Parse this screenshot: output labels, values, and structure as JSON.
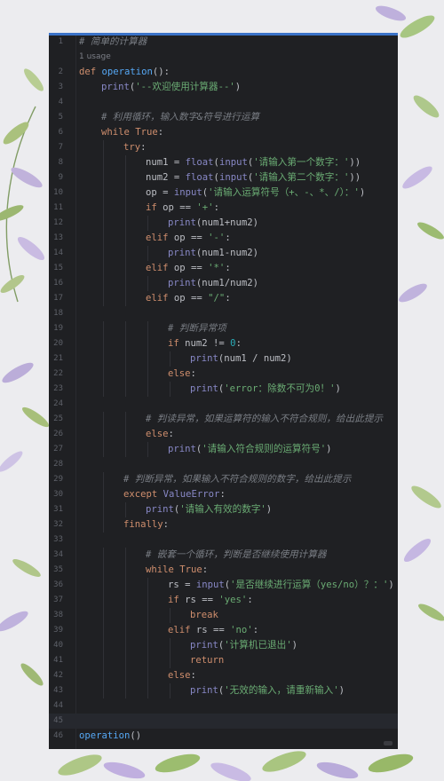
{
  "colors": {
    "editor_bg": "#1f2023",
    "keyword": "#cf8e6d",
    "function": "#56a8f5",
    "builtin": "#8888c6",
    "string": "#6aab73",
    "number": "#2aacb8",
    "comment": "#7a7e85"
  },
  "usage_hint": "1 usage",
  "current_line": 45,
  "lines": [
    {
      "n": "1",
      "i": 0,
      "t": [
        [
          "cm",
          "# 简单的计算器"
        ]
      ]
    },
    {
      "n": "2",
      "i": 0,
      "t": [
        [
          "kw",
          "def "
        ],
        [
          "fn",
          "operation"
        ],
        [
          "op",
          "():"
        ]
      ]
    },
    {
      "n": "3",
      "i": 1,
      "t": [
        [
          "bi",
          "print"
        ],
        [
          "op",
          "("
        ],
        [
          "str",
          "'--欢迎使用计算器--'"
        ],
        [
          "op",
          ")"
        ]
      ]
    },
    {
      "n": "4",
      "i": 0,
      "t": []
    },
    {
      "n": "5",
      "i": 1,
      "t": [
        [
          "cm",
          "# 利用循环，输入数字&符号进行运算"
        ]
      ]
    },
    {
      "n": "6",
      "i": 1,
      "t": [
        [
          "kw",
          "while "
        ],
        [
          "kw",
          "True"
        ],
        [
          "op",
          ":"
        ]
      ]
    },
    {
      "n": "7",
      "i": 2,
      "t": [
        [
          "kw",
          "try"
        ],
        [
          "op",
          ":"
        ]
      ]
    },
    {
      "n": "8",
      "i": 3,
      "t": [
        [
          "op",
          "num1 = "
        ],
        [
          "bi",
          "float"
        ],
        [
          "op",
          "("
        ],
        [
          "bi",
          "input"
        ],
        [
          "op",
          "("
        ],
        [
          "str",
          "'请输入第一个数字：'"
        ],
        [
          "op",
          "))"
        ]
      ]
    },
    {
      "n": "9",
      "i": 3,
      "t": [
        [
          "op",
          "num2 = "
        ],
        [
          "bi",
          "float"
        ],
        [
          "op",
          "("
        ],
        [
          "bi",
          "input"
        ],
        [
          "op",
          "("
        ],
        [
          "str",
          "'请输入第二个数字：'"
        ],
        [
          "op",
          "))"
        ]
      ]
    },
    {
      "n": "10",
      "i": 3,
      "t": [
        [
          "op",
          "op = "
        ],
        [
          "bi",
          "input"
        ],
        [
          "op",
          "("
        ],
        [
          "str",
          "'请输入运算符号（+、-、*、/）：'"
        ],
        [
          "op",
          ")"
        ]
      ]
    },
    {
      "n": "11",
      "i": 3,
      "t": [
        [
          "kw",
          "if "
        ],
        [
          "op",
          "op == "
        ],
        [
          "str",
          "'+'"
        ],
        [
          "op",
          ":"
        ]
      ]
    },
    {
      "n": "12",
      "i": 4,
      "t": [
        [
          "bi",
          "print"
        ],
        [
          "op",
          "(num1+num2)"
        ]
      ]
    },
    {
      "n": "13",
      "i": 3,
      "t": [
        [
          "kw",
          "elif "
        ],
        [
          "op",
          "op == "
        ],
        [
          "str",
          "'-'"
        ],
        [
          "op",
          ":"
        ]
      ]
    },
    {
      "n": "14",
      "i": 4,
      "t": [
        [
          "bi",
          "print"
        ],
        [
          "op",
          "(num1-num2)"
        ]
      ]
    },
    {
      "n": "15",
      "i": 3,
      "t": [
        [
          "kw",
          "elif "
        ],
        [
          "op",
          "op == "
        ],
        [
          "str",
          "'*'"
        ],
        [
          "op",
          ":"
        ]
      ]
    },
    {
      "n": "16",
      "i": 4,
      "t": [
        [
          "bi",
          "print"
        ],
        [
          "op",
          "(num1/num2)"
        ]
      ]
    },
    {
      "n": "17",
      "i": 3,
      "t": [
        [
          "kw",
          "elif "
        ],
        [
          "op",
          "op == "
        ],
        [
          "str",
          "\"/\""
        ],
        [
          "op",
          ":"
        ]
      ]
    },
    {
      "n": "18",
      "i": 0,
      "t": []
    },
    {
      "n": "19",
      "i": 4,
      "t": [
        [
          "cm",
          "# 判断异常项"
        ]
      ]
    },
    {
      "n": "20",
      "i": 4,
      "t": [
        [
          "kw",
          "if "
        ],
        [
          "op",
          "num2 != "
        ],
        [
          "num",
          "0"
        ],
        [
          "op",
          ":"
        ]
      ]
    },
    {
      "n": "21",
      "i": 5,
      "t": [
        [
          "bi",
          "print"
        ],
        [
          "op",
          "(num1 / num2)"
        ]
      ]
    },
    {
      "n": "22",
      "i": 4,
      "t": [
        [
          "kw",
          "else"
        ],
        [
          "op",
          ":"
        ]
      ]
    },
    {
      "n": "23",
      "i": 5,
      "t": [
        [
          "bi",
          "print"
        ],
        [
          "op",
          "("
        ],
        [
          "str",
          "'error：除数不可为0！'"
        ],
        [
          "op",
          ")"
        ]
      ]
    },
    {
      "n": "24",
      "i": 0,
      "t": []
    },
    {
      "n": "25",
      "i": 3,
      "t": [
        [
          "cm",
          "# 判读异常，如果运算符的输入不符合规则，给出此提示"
        ]
      ]
    },
    {
      "n": "26",
      "i": 3,
      "t": [
        [
          "kw",
          "else"
        ],
        [
          "op",
          ":"
        ]
      ]
    },
    {
      "n": "27",
      "i": 4,
      "t": [
        [
          "bi",
          "print"
        ],
        [
          "op",
          "("
        ],
        [
          "str",
          "'请输入符合规则的运算符号'"
        ],
        [
          "op",
          ")"
        ]
      ]
    },
    {
      "n": "28",
      "i": 0,
      "t": []
    },
    {
      "n": "29",
      "i": 2,
      "t": [
        [
          "cm",
          "# 判断异常，如果输入不符合规则的数字，给出此提示"
        ]
      ]
    },
    {
      "n": "30",
      "i": 2,
      "t": [
        [
          "kw",
          "except "
        ],
        [
          "bi",
          "ValueError"
        ],
        [
          "op",
          ":"
        ]
      ]
    },
    {
      "n": "31",
      "i": 3,
      "t": [
        [
          "bi",
          "print"
        ],
        [
          "op",
          "("
        ],
        [
          "str",
          "'请输入有效的数字'"
        ],
        [
          "op",
          ")"
        ]
      ]
    },
    {
      "n": "32",
      "i": 2,
      "t": [
        [
          "kw",
          "finally"
        ],
        [
          "op",
          ":"
        ]
      ]
    },
    {
      "n": "33",
      "i": 0,
      "t": []
    },
    {
      "n": "34",
      "i": 3,
      "t": [
        [
          "cm",
          "# 嵌套一个循环，判断是否继续使用计算器"
        ]
      ]
    },
    {
      "n": "35",
      "i": 3,
      "t": [
        [
          "kw",
          "while "
        ],
        [
          "kw",
          "True"
        ],
        [
          "op",
          ":"
        ]
      ]
    },
    {
      "n": "36",
      "i": 4,
      "t": [
        [
          "op",
          "rs = "
        ],
        [
          "bi",
          "input"
        ],
        [
          "op",
          "("
        ],
        [
          "str",
          "'是否继续进行运算（yes/no）？：'"
        ],
        [
          "op",
          ")"
        ]
      ]
    },
    {
      "n": "37",
      "i": 4,
      "t": [
        [
          "kw",
          "if "
        ],
        [
          "op",
          "rs == "
        ],
        [
          "str",
          "'yes'"
        ],
        [
          "op",
          ":"
        ]
      ]
    },
    {
      "n": "38",
      "i": 5,
      "t": [
        [
          "kw",
          "break"
        ]
      ]
    },
    {
      "n": "39",
      "i": 4,
      "t": [
        [
          "kw",
          "elif "
        ],
        [
          "op",
          "rs == "
        ],
        [
          "str",
          "'no'"
        ],
        [
          "op",
          ":"
        ]
      ]
    },
    {
      "n": "40",
      "i": 5,
      "t": [
        [
          "bi",
          "print"
        ],
        [
          "op",
          "("
        ],
        [
          "str",
          "'计算机已退出'"
        ],
        [
          "op",
          ")"
        ]
      ]
    },
    {
      "n": "41",
      "i": 5,
      "t": [
        [
          "kw",
          "return"
        ]
      ]
    },
    {
      "n": "42",
      "i": 4,
      "t": [
        [
          "kw",
          "else"
        ],
        [
          "op",
          ":"
        ]
      ]
    },
    {
      "n": "43",
      "i": 5,
      "t": [
        [
          "bi",
          "print"
        ],
        [
          "op",
          "("
        ],
        [
          "str",
          "'无效的输入，请重新输入'"
        ],
        [
          "op",
          ")"
        ]
      ]
    },
    {
      "n": "44",
      "i": 0,
      "t": []
    },
    {
      "n": "45",
      "i": 0,
      "t": []
    },
    {
      "n": "46",
      "i": 0,
      "t": [
        [
          "fn",
          "operation"
        ],
        [
          "op",
          "()"
        ]
      ]
    }
  ]
}
